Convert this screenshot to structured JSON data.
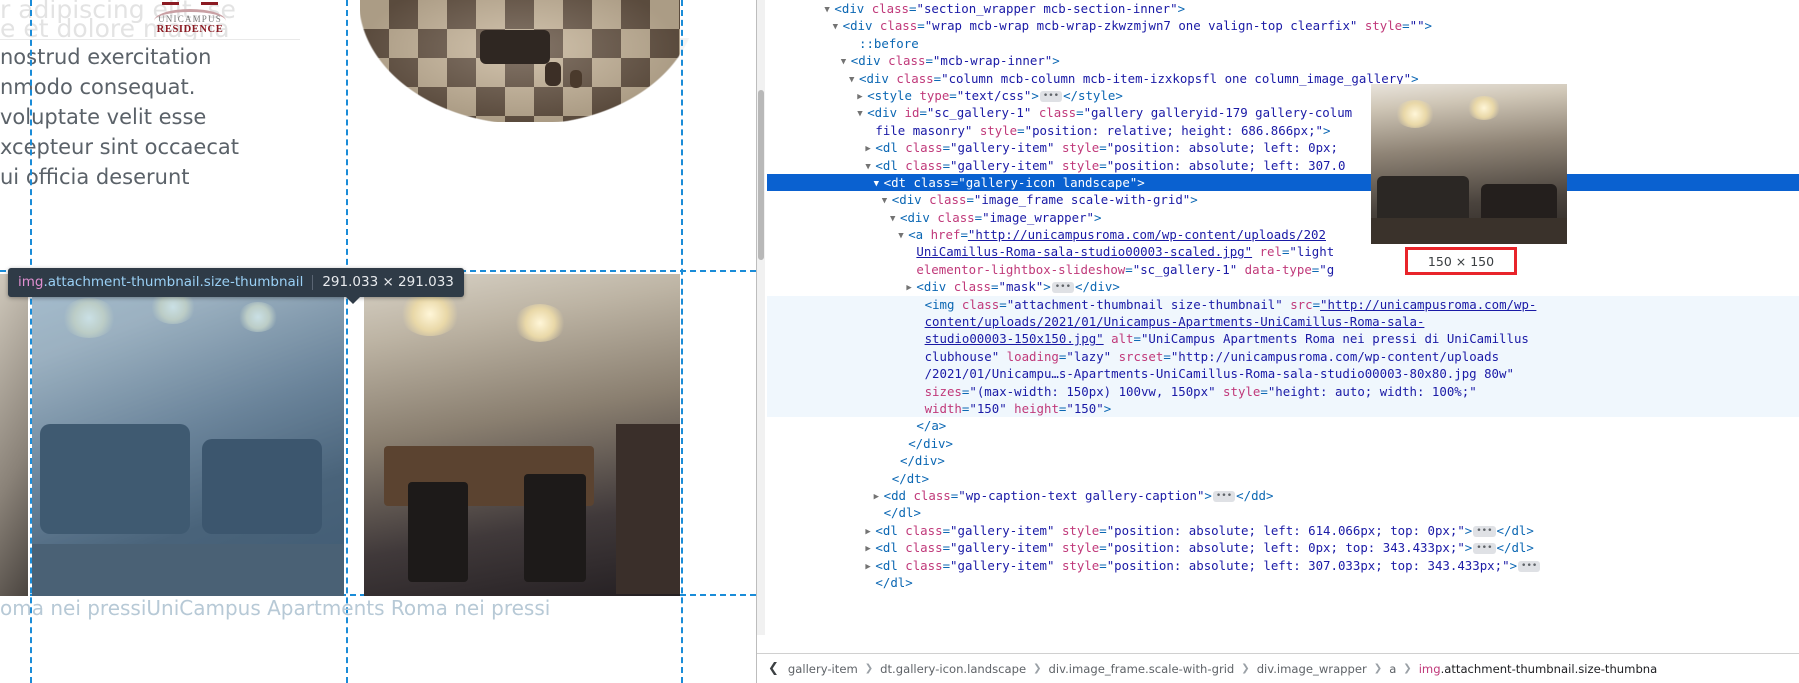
{
  "page": {
    "logo": {
      "line1": "UNICAMPUS",
      "line2": "RESIDENCE"
    },
    "hero_faint_lines": [
      "r adipiscing elit, se",
      "e et dolore magna"
    ],
    "body_lines": [
      "nostrud exercitation",
      "nmodo consequat.",
      " voluptate velit esse",
      "xcepteur sint occaecat",
      "ui officia deserunt"
    ],
    "caption_line": "oma nei pressiUniCampus Apartments Roma nei pressi",
    "menu_icon": "hamburger-menu-icon"
  },
  "inspector_tooltip": {
    "selector_prefix": "img",
    "selector_classes": ".attachment-thumbnail.size-thumbnail",
    "dimensions": "291.033 × 291.033"
  },
  "preview": {
    "size_badge": "150 × 150"
  },
  "devtools": {
    "dom_lines": [
      {
        "indent": 7,
        "tri": "down",
        "html": "<span class=\"tok-punct\">&lt;</span><span class=\"tok-tag\">div</span> <span class=\"tok-attr\">class</span><span class=\"tok-punct\">=</span><span class=\"tok-val\">\"section_wrapper mcb-section-inner\"</span><span class=\"tok-punct\">&gt;</span>"
      },
      {
        "indent": 8,
        "tri": "down",
        "html": "<span class=\"tok-punct\">&lt;</span><span class=\"tok-tag\">div</span> <span class=\"tok-attr\">class</span><span class=\"tok-punct\">=</span><span class=\"tok-val\">\"wrap mcb-wrap mcb-wrap-zkwzmjwn7 one valign-top clearfix\"</span> <span class=\"tok-attr\">style</span><span class=\"tok-punct\">=</span><span class=\"tok-val\">\"\"</span><span class=\"tok-punct\">&gt;</span>"
      },
      {
        "indent": 10,
        "tri": "none",
        "html": "<span class=\"tok-pseudo\">::before</span>"
      },
      {
        "indent": 9,
        "tri": "down",
        "html": "<span class=\"tok-punct\">&lt;</span><span class=\"tok-tag\">div</span> <span class=\"tok-attr\">class</span><span class=\"tok-punct\">=</span><span class=\"tok-val\">\"mcb-wrap-inner\"</span><span class=\"tok-punct\">&gt;</span>"
      },
      {
        "indent": 10,
        "tri": "down",
        "html": "<span class=\"tok-punct\">&lt;</span><span class=\"tok-tag\">div</span> <span class=\"tok-attr\">class</span><span class=\"tok-punct\">=</span><span class=\"tok-val\">\"column mcb-column mcb-item-izxkopsfl one column_image_gallery\"</span><span class=\"tok-punct\">&gt;</span>"
      },
      {
        "indent": 11,
        "tri": "right",
        "html": "<span class=\"tok-punct\">&lt;</span><span class=\"tok-tag\">style</span> <span class=\"tok-attr\">type</span><span class=\"tok-punct\">=</span><span class=\"tok-val\">\"text/css\"</span><span class=\"tok-punct\">&gt;</span><span class=\"ell\">•••</span><span class=\"tok-punct\">&lt;/</span><span class=\"tok-tag\">style</span><span class=\"tok-punct\">&gt;</span>"
      },
      {
        "indent": 11,
        "tri": "down",
        "html": "<span class=\"tok-punct\">&lt;</span><span class=\"tok-tag\">div</span> <span class=\"tok-attr\">id</span><span class=\"tok-punct\">=</span><span class=\"tok-val\">\"sc_gallery-1\"</span> <span class=\"tok-attr\">class</span><span class=\"tok-punct\">=</span><span class=\"tok-val\">\"gallery galleryid-179 gallery-colum</span>"
      },
      {
        "indent": 12,
        "tri": "none",
        "html": "<span class=\"tok-val\">file masonry\"</span> <span class=\"tok-attr\">style</span><span class=\"tok-punct\">=</span><span class=\"tok-val\">\"position: relative; height: 686.866px;\"</span><span class=\"tok-punct\">&gt;</span>"
      },
      {
        "indent": 12,
        "tri": "right",
        "html": "<span class=\"tok-punct\">&lt;</span><span class=\"tok-tag\">dl</span> <span class=\"tok-attr\">class</span><span class=\"tok-punct\">=</span><span class=\"tok-val\">\"gallery-item\"</span> <span class=\"tok-attr\">style</span><span class=\"tok-punct\">=</span><span class=\"tok-val\">\"position: absolute; left: 0px;</span>"
      },
      {
        "indent": 12,
        "tri": "down",
        "html": "<span class=\"tok-punct\">&lt;</span><span class=\"tok-tag\">dl</span> <span class=\"tok-attr\">class</span><span class=\"tok-punct\">=</span><span class=\"tok-val\">\"gallery-item\"</span> <span class=\"tok-attr\">style</span><span class=\"tok-punct\">=</span><span class=\"tok-val\">\"position: absolute; left: 307.0</span>"
      },
      {
        "indent": 13,
        "tri": "down",
        "sel": true,
        "html": "<span class=\"tok-punct\">&lt;</span><span class=\"tok-tag\">dt</span> <span class=\"tok-attr\">class</span><span class=\"tok-punct\">=</span><span class=\"tok-val\">\"gallery-icon landscape\"</span><span class=\"tok-punct\">&gt;</span>"
      },
      {
        "indent": 14,
        "tri": "down",
        "html": "<span class=\"tok-punct\">&lt;</span><span class=\"tok-tag\">div</span> <span class=\"tok-attr\">class</span><span class=\"tok-punct\">=</span><span class=\"tok-val\">\"image_frame scale-with-grid\"</span><span class=\"tok-punct\">&gt;</span>"
      },
      {
        "indent": 15,
        "tri": "down",
        "html": "<span class=\"tok-punct\">&lt;</span><span class=\"tok-tag\">div</span> <span class=\"tok-attr\">class</span><span class=\"tok-punct\">=</span><span class=\"tok-val\">\"image_wrapper\"</span><span class=\"tok-punct\">&gt;</span>"
      },
      {
        "indent": 16,
        "tri": "down",
        "html": "<span class=\"tok-punct\">&lt;</span><span class=\"tok-tag\">a</span> <span class=\"tok-attr\">href</span><span class=\"tok-punct\">=</span><span class=\"tok-val-link\">\"http://unicampusroma.com/wp-content/uploads/202</span>"
      },
      {
        "indent": 17,
        "tri": "none",
        "html": "<span class=\"tok-val-link\">UniCamillus-Roma-sala-studio00003-scaled.jpg\"</span> <span class=\"tok-attr\">rel</span><span class=\"tok-punct\">=</span><span class=\"tok-val\">\"light</span>"
      },
      {
        "indent": 17,
        "tri": "none",
        "html": "<span class=\"tok-attr\">elementor-lightbox-slideshow</span><span class=\"tok-punct\">=</span><span class=\"tok-val\">\"sc_gallery-1\"</span> <span class=\"tok-attr\">data-type</span><span class=\"tok-punct\">=</span><span class=\"tok-val\">\"g</span>"
      },
      {
        "indent": 17,
        "tri": "right",
        "html": "<span class=\"tok-punct\">&lt;</span><span class=\"tok-tag\">div</span> <span class=\"tok-attr\">class</span><span class=\"tok-punct\">=</span><span class=\"tok-val\">\"mask\"</span><span class=\"tok-punct\">&gt;</span><span class=\"ell\">•••</span><span class=\"tok-punct\">&lt;/</span><span class=\"tok-tag\">div</span><span class=\"tok-punct\">&gt;</span>"
      },
      {
        "indent": 18,
        "tri": "none",
        "alt": true,
        "html": "<span class=\"tok-punct\">&lt;</span><span class=\"tok-tag\">img</span> <span class=\"tok-attr\">class</span><span class=\"tok-punct\">=</span><span class=\"tok-val\">\"attachment-thumbnail size-thumbnail\"</span> <span class=\"tok-attr\">src</span><span class=\"tok-punct\">=</span><span class=\"tok-val-link\">\"http://unicampusroma.com/wp-</span>"
      },
      {
        "indent": 18,
        "tri": "none",
        "alt": true,
        "html": "<span class=\"tok-val-link\">content/uploads/2021/01/Unicampus-Apartments-UniCamillus-Roma-sala-</span>"
      },
      {
        "indent": 18,
        "tri": "none",
        "alt": true,
        "html": "<span class=\"tok-val-link\">studio00003-150x150.jpg\"</span> <span class=\"tok-attr\">alt</span><span class=\"tok-punct\">=</span><span class=\"tok-val\">\"UniCampus Apartments Roma nei pressi di UniCamillus</span>"
      },
      {
        "indent": 18,
        "tri": "none",
        "alt": true,
        "html": "<span class=\"tok-val\">clubhouse\"</span> <span class=\"tok-attr\">loading</span><span class=\"tok-punct\">=</span><span class=\"tok-val\">\"lazy\"</span> <span class=\"tok-attr\">srcset</span><span class=\"tok-punct\">=</span><span class=\"tok-val\">\"http://unicampusroma.com/wp-content/uploads</span>"
      },
      {
        "indent": 18,
        "tri": "none",
        "alt": true,
        "html": "<span class=\"tok-val\">/2021/01/Unicampu…s-Apartments-UniCamillus-Roma-sala-studio00003-80x80.jpg 80w\"</span>"
      },
      {
        "indent": 18,
        "tri": "none",
        "alt": true,
        "html": "<span class=\"tok-attr\">sizes</span><span class=\"tok-punct\">=</span><span class=\"tok-val\">\"(max-width: 150px) 100vw, 150px\"</span> <span class=\"tok-attr\">style</span><span class=\"tok-punct\">=</span><span class=\"tok-val\">\"height: auto; width: 100%;\"</span>"
      },
      {
        "indent": 18,
        "tri": "none",
        "alt": true,
        "html": "<span class=\"tok-attr\">width</span><span class=\"tok-punct\">=</span><span class=\"tok-val\">\"150\"</span> <span class=\"tok-attr\">height</span><span class=\"tok-punct\">=</span><span class=\"tok-val\">\"150\"</span><span class=\"tok-punct\">&gt;</span>"
      },
      {
        "indent": 17,
        "tri": "none",
        "html": "<span class=\"tok-punct\">&lt;/</span><span class=\"tok-tag\">a</span><span class=\"tok-punct\">&gt;</span>"
      },
      {
        "indent": 16,
        "tri": "none",
        "html": "<span class=\"tok-punct\">&lt;/</span><span class=\"tok-tag\">div</span><span class=\"tok-punct\">&gt;</span>"
      },
      {
        "indent": 15,
        "tri": "none",
        "html": "<span class=\"tok-punct\">&lt;/</span><span class=\"tok-tag\">div</span><span class=\"tok-punct\">&gt;</span>"
      },
      {
        "indent": 14,
        "tri": "none",
        "html": "<span class=\"tok-punct\">&lt;/</span><span class=\"tok-tag\">dt</span><span class=\"tok-punct\">&gt;</span>"
      },
      {
        "indent": 13,
        "tri": "right",
        "html": "<span class=\"tok-punct\">&lt;</span><span class=\"tok-tag\">dd</span> <span class=\"tok-attr\">class</span><span class=\"tok-punct\">=</span><span class=\"tok-val\">\"wp-caption-text gallery-caption\"</span><span class=\"tok-punct\">&gt;</span><span class=\"ell\">•••</span><span class=\"tok-punct\">&lt;/</span><span class=\"tok-tag\">dd</span><span class=\"tok-punct\">&gt;</span>"
      },
      {
        "indent": 13,
        "tri": "none",
        "html": "<span class=\"tok-punct\">&lt;/</span><span class=\"tok-tag\">dl</span><span class=\"tok-punct\">&gt;</span>"
      },
      {
        "indent": 12,
        "tri": "right",
        "html": "<span class=\"tok-punct\">&lt;</span><span class=\"tok-tag\">dl</span> <span class=\"tok-attr\">class</span><span class=\"tok-punct\">=</span><span class=\"tok-val\">\"gallery-item\"</span> <span class=\"tok-attr\">style</span><span class=\"tok-punct\">=</span><span class=\"tok-val\">\"position: absolute; left: 614.066px; top: 0px;\"</span><span class=\"tok-punct\">&gt;</span><span class=\"ell\">•••</span><span class=\"tok-punct\">&lt;/</span><span class=\"tok-tag\">dl</span><span class=\"tok-punct\">&gt;</span>"
      },
      {
        "indent": 12,
        "tri": "right",
        "html": "<span class=\"tok-punct\">&lt;</span><span class=\"tok-tag\">dl</span> <span class=\"tok-attr\">class</span><span class=\"tok-punct\">=</span><span class=\"tok-val\">\"gallery-item\"</span> <span class=\"tok-attr\">style</span><span class=\"tok-punct\">=</span><span class=\"tok-val\">\"position: absolute; left: 0px; top: 343.433px;\"</span><span class=\"tok-punct\">&gt;</span><span class=\"ell\">•••</span><span class=\"tok-punct\">&lt;/</span><span class=\"tok-tag\">dl</span><span class=\"tok-punct\">&gt;</span>"
      },
      {
        "indent": 12,
        "tri": "right",
        "html": "<span class=\"tok-punct\">&lt;</span><span class=\"tok-tag\">dl</span> <span class=\"tok-attr\">class</span><span class=\"tok-punct\">=</span><span class=\"tok-val\">\"gallery-item\"</span> <span class=\"tok-attr\">style</span><span class=\"tok-punct\">=</span><span class=\"tok-val\">\"position: absolute; left: 307.033px; top: 343.433px;\"</span><span class=\"tok-punct\">&gt;</span><span class=\"ell\">•••</span>"
      },
      {
        "indent": 12,
        "tri": "none",
        "html": "<span class=\"tok-punct\">&lt;/</span><span class=\"tok-tag\">dl</span><span class=\"tok-punct\">&gt;</span>"
      }
    ],
    "breadcrumb": {
      "back_icon": "chevron-left-icon",
      "items": [
        {
          "text": "gallery-item",
          "mag": ""
        },
        {
          "text": "dt.gallery-icon.landscape",
          "mag": ""
        },
        {
          "text": "div.image_frame.scale-with-grid",
          "mag": ""
        },
        {
          "text": "div.image_wrapper",
          "mag": ""
        },
        {
          "text": "a",
          "mag": ""
        },
        {
          "text": "img.attachment-thumbnail.size-thumbna",
          "mag": "img"
        }
      ],
      "separator": "❯"
    }
  },
  "colors": {
    "selection_blue": "#0a61d0",
    "highlight_overlay": "#68b6ff",
    "dashed_guide": "#1a8cd8",
    "badge_red": "#e8242a",
    "brand_maroon": "#8b1a22",
    "tooltip_bg": "#2f3b47"
  }
}
